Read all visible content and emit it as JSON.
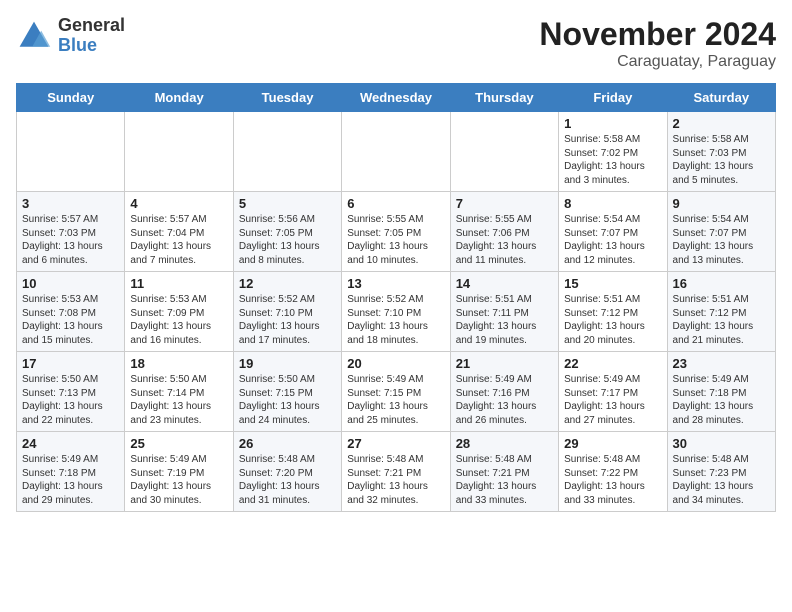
{
  "logo": {
    "general": "General",
    "blue": "Blue"
  },
  "title": "November 2024",
  "location": "Caraguatay, Paraguay",
  "days_of_week": [
    "Sunday",
    "Monday",
    "Tuesday",
    "Wednesday",
    "Thursday",
    "Friday",
    "Saturday"
  ],
  "weeks": [
    [
      {
        "day": "",
        "info": ""
      },
      {
        "day": "",
        "info": ""
      },
      {
        "day": "",
        "info": ""
      },
      {
        "day": "",
        "info": ""
      },
      {
        "day": "",
        "info": ""
      },
      {
        "day": "1",
        "info": "Sunrise: 5:58 AM\nSunset: 7:02 PM\nDaylight: 13 hours\nand 3 minutes."
      },
      {
        "day": "2",
        "info": "Sunrise: 5:58 AM\nSunset: 7:03 PM\nDaylight: 13 hours\nand 5 minutes."
      }
    ],
    [
      {
        "day": "3",
        "info": "Sunrise: 5:57 AM\nSunset: 7:03 PM\nDaylight: 13 hours\nand 6 minutes."
      },
      {
        "day": "4",
        "info": "Sunrise: 5:57 AM\nSunset: 7:04 PM\nDaylight: 13 hours\nand 7 minutes."
      },
      {
        "day": "5",
        "info": "Sunrise: 5:56 AM\nSunset: 7:05 PM\nDaylight: 13 hours\nand 8 minutes."
      },
      {
        "day": "6",
        "info": "Sunrise: 5:55 AM\nSunset: 7:05 PM\nDaylight: 13 hours\nand 10 minutes."
      },
      {
        "day": "7",
        "info": "Sunrise: 5:55 AM\nSunset: 7:06 PM\nDaylight: 13 hours\nand 11 minutes."
      },
      {
        "day": "8",
        "info": "Sunrise: 5:54 AM\nSunset: 7:07 PM\nDaylight: 13 hours\nand 12 minutes."
      },
      {
        "day": "9",
        "info": "Sunrise: 5:54 AM\nSunset: 7:07 PM\nDaylight: 13 hours\nand 13 minutes."
      }
    ],
    [
      {
        "day": "10",
        "info": "Sunrise: 5:53 AM\nSunset: 7:08 PM\nDaylight: 13 hours\nand 15 minutes."
      },
      {
        "day": "11",
        "info": "Sunrise: 5:53 AM\nSunset: 7:09 PM\nDaylight: 13 hours\nand 16 minutes."
      },
      {
        "day": "12",
        "info": "Sunrise: 5:52 AM\nSunset: 7:10 PM\nDaylight: 13 hours\nand 17 minutes."
      },
      {
        "day": "13",
        "info": "Sunrise: 5:52 AM\nSunset: 7:10 PM\nDaylight: 13 hours\nand 18 minutes."
      },
      {
        "day": "14",
        "info": "Sunrise: 5:51 AM\nSunset: 7:11 PM\nDaylight: 13 hours\nand 19 minutes."
      },
      {
        "day": "15",
        "info": "Sunrise: 5:51 AM\nSunset: 7:12 PM\nDaylight: 13 hours\nand 20 minutes."
      },
      {
        "day": "16",
        "info": "Sunrise: 5:51 AM\nSunset: 7:12 PM\nDaylight: 13 hours\nand 21 minutes."
      }
    ],
    [
      {
        "day": "17",
        "info": "Sunrise: 5:50 AM\nSunset: 7:13 PM\nDaylight: 13 hours\nand 22 minutes."
      },
      {
        "day": "18",
        "info": "Sunrise: 5:50 AM\nSunset: 7:14 PM\nDaylight: 13 hours\nand 23 minutes."
      },
      {
        "day": "19",
        "info": "Sunrise: 5:50 AM\nSunset: 7:15 PM\nDaylight: 13 hours\nand 24 minutes."
      },
      {
        "day": "20",
        "info": "Sunrise: 5:49 AM\nSunset: 7:15 PM\nDaylight: 13 hours\nand 25 minutes."
      },
      {
        "day": "21",
        "info": "Sunrise: 5:49 AM\nSunset: 7:16 PM\nDaylight: 13 hours\nand 26 minutes."
      },
      {
        "day": "22",
        "info": "Sunrise: 5:49 AM\nSunset: 7:17 PM\nDaylight: 13 hours\nand 27 minutes."
      },
      {
        "day": "23",
        "info": "Sunrise: 5:49 AM\nSunset: 7:18 PM\nDaylight: 13 hours\nand 28 minutes."
      }
    ],
    [
      {
        "day": "24",
        "info": "Sunrise: 5:49 AM\nSunset: 7:18 PM\nDaylight: 13 hours\nand 29 minutes."
      },
      {
        "day": "25",
        "info": "Sunrise: 5:49 AM\nSunset: 7:19 PM\nDaylight: 13 hours\nand 30 minutes."
      },
      {
        "day": "26",
        "info": "Sunrise: 5:48 AM\nSunset: 7:20 PM\nDaylight: 13 hours\nand 31 minutes."
      },
      {
        "day": "27",
        "info": "Sunrise: 5:48 AM\nSunset: 7:21 PM\nDaylight: 13 hours\nand 32 minutes."
      },
      {
        "day": "28",
        "info": "Sunrise: 5:48 AM\nSunset: 7:21 PM\nDaylight: 13 hours\nand 33 minutes."
      },
      {
        "day": "29",
        "info": "Sunrise: 5:48 AM\nSunset: 7:22 PM\nDaylight: 13 hours\nand 33 minutes."
      },
      {
        "day": "30",
        "info": "Sunrise: 5:48 AM\nSunset: 7:23 PM\nDaylight: 13 hours\nand 34 minutes."
      }
    ]
  ]
}
